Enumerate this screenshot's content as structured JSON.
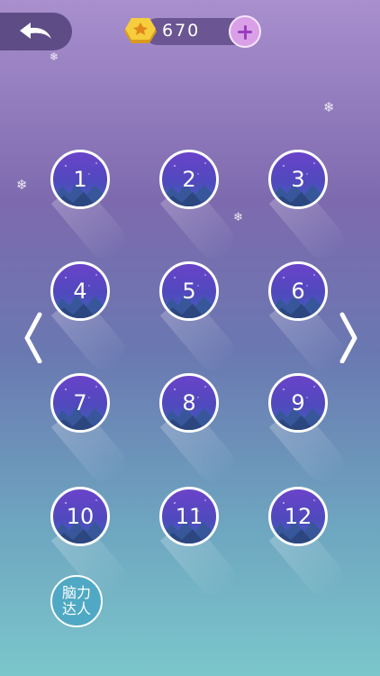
{
  "header": {
    "back_icon": "back-arrow-icon",
    "coin_icon": "hexagon-coin-icon",
    "coins": "670",
    "add_icon": "plus-icon"
  },
  "levels": [
    {
      "label": "1"
    },
    {
      "label": "2"
    },
    {
      "label": "3"
    },
    {
      "label": "4"
    },
    {
      "label": "5"
    },
    {
      "label": "6"
    },
    {
      "label": "7"
    },
    {
      "label": "8"
    },
    {
      "label": "9"
    },
    {
      "label": "10"
    },
    {
      "label": "11"
    },
    {
      "label": "12"
    }
  ],
  "nav": {
    "prev_icon": "chevron-left-icon",
    "next_icon": "chevron-right-icon"
  },
  "badge": {
    "line1": "脑力",
    "line2": "达人"
  },
  "colors": {
    "accent": "#d9a0e8",
    "level_disc_top": "#6a43c9",
    "level_disc_bottom": "#3f64b8",
    "badge": "#4fa9c4"
  }
}
